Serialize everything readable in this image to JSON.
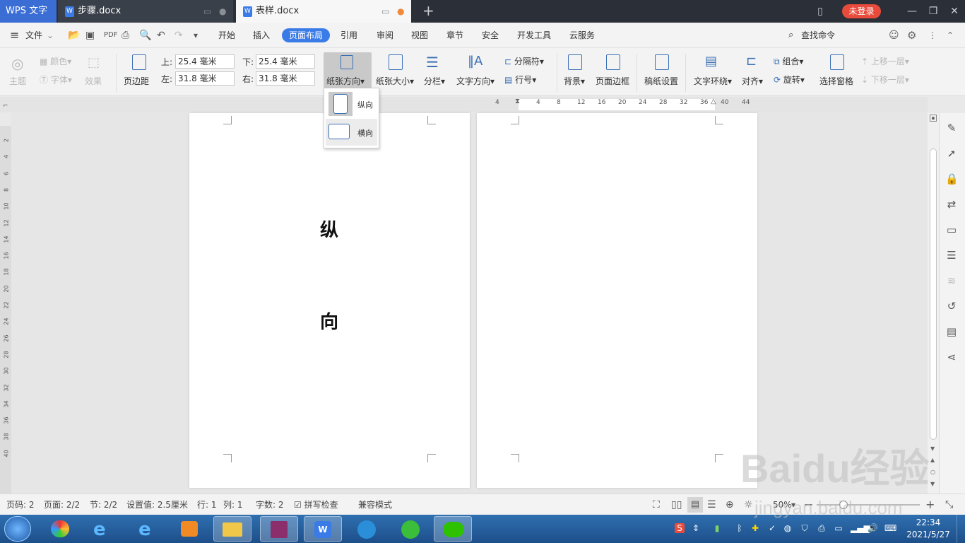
{
  "titlebar": {
    "app_name": "WPS 文字",
    "tabs": [
      {
        "label": "步骤.docx"
      },
      {
        "label": "表样.docx"
      }
    ],
    "new_tab_symbol": "+",
    "login_label": "未登录"
  },
  "menubar": {
    "file_label": "文件",
    "items": [
      "开始",
      "插入",
      "页面布局",
      "引用",
      "审阅",
      "视图",
      "章节",
      "安全",
      "开发工具",
      "云服务"
    ],
    "active_item": "页面布局",
    "search_label": "查找命令"
  },
  "ribbon": {
    "theme": "主题",
    "color": "颜色",
    "font": "字体",
    "effect": "效果",
    "page_margin": "页边距",
    "top_label": "上:",
    "bottom_label": "下:",
    "left_label": "左:",
    "right_label": "右:",
    "top_value": "25.4 毫米",
    "bottom_value": "25.4 毫米",
    "left_value": "31.8 毫米",
    "right_value": "31.8 毫米",
    "orientation": "纸张方向",
    "paper_size": "纸张大小",
    "columns": "分栏",
    "text_direction": "文字方向",
    "separator": "分隔符",
    "line_number": "行号",
    "background": "背景",
    "page_border": "页面边框",
    "draft_paper": "稿纸设置",
    "text_wrap": "文字环绕",
    "align": "对齐",
    "group": "组合",
    "rotate": "旋转",
    "select_pane": "选择窗格",
    "bring_forward": "上移一层",
    "send_backward": "下移一层"
  },
  "orientation_menu": {
    "portrait": "纵向",
    "landscape": "横向"
  },
  "ruler": {
    "h_ticks": [
      "4",
      "4",
      "8",
      "12",
      "16",
      "20",
      "24",
      "28",
      "32",
      "36",
      "40",
      "44"
    ],
    "v_ticks": [
      "2",
      "4",
      "6",
      "8",
      "10",
      "12",
      "14",
      "16",
      "18",
      "20",
      "22",
      "24",
      "26",
      "28",
      "30",
      "32",
      "34",
      "36",
      "38",
      "40"
    ]
  },
  "document": {
    "page1_chars": [
      "纵",
      "向"
    ]
  },
  "statusbar": {
    "page": "页码: 2",
    "pages": "页面: 2/2",
    "section": "节: 2/2",
    "setting": "设置值: 2.5厘米",
    "row": "行: 1",
    "col": "列: 1",
    "word_count": "字数: 2",
    "spell_check": "拼写检查",
    "compat_mode": "兼容模式",
    "zoom": "50%"
  },
  "taskbar": {
    "time": "22:34",
    "date": "2021/5/27"
  },
  "watermark": {
    "brand": "Baidu经验",
    "url": "jingyan.baidu.com"
  }
}
